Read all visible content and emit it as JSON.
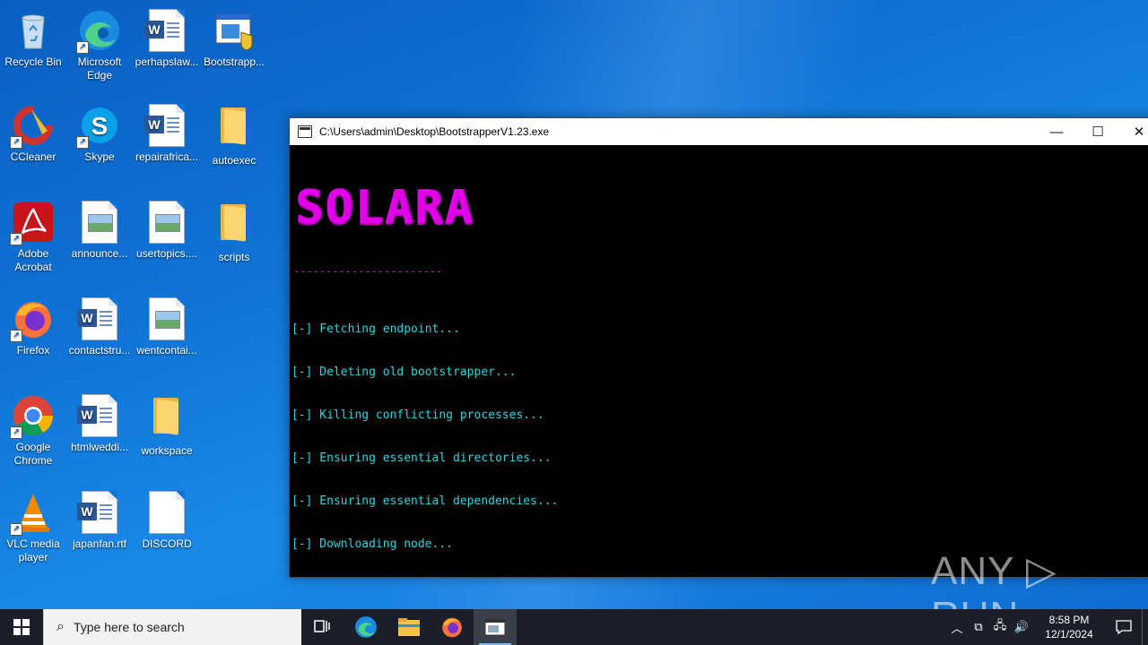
{
  "desktop": {
    "icons": [
      {
        "label": "Recycle Bin",
        "type": "recycle-bin"
      },
      {
        "label": "Microsoft Edge",
        "type": "edge"
      },
      {
        "label": "perhapslaw...",
        "type": "word-doc"
      },
      {
        "label": "Bootstrapp...",
        "type": "exe"
      },
      {
        "label": "CCleaner",
        "type": "ccleaner"
      },
      {
        "label": "Skype",
        "type": "skype"
      },
      {
        "label": "repairafrica...",
        "type": "word-doc"
      },
      {
        "label": "autoexec",
        "type": "folder"
      },
      {
        "label": "Adobe Acrobat",
        "type": "acrobat"
      },
      {
        "label": "announce...",
        "type": "image-file"
      },
      {
        "label": "usertopics....",
        "type": "image-file"
      },
      {
        "label": "scripts",
        "type": "folder"
      },
      {
        "label": "Firefox",
        "type": "firefox"
      },
      {
        "label": "contactstru...",
        "type": "word-doc"
      },
      {
        "label": "wentcontai...",
        "type": "image-file"
      },
      {
        "label": "Google Chrome",
        "type": "chrome"
      },
      {
        "label": "htmlweddi...",
        "type": "word-doc"
      },
      {
        "label": "workspace",
        "type": "folder"
      },
      {
        "label": "VLC media player",
        "type": "vlc"
      },
      {
        "label": "japanfan.rtf",
        "type": "word-doc"
      },
      {
        "label": "DISCORD",
        "type": "blank-file"
      }
    ]
  },
  "console": {
    "title": "C:\\Users\\admin\\Desktop\\BootstrapperV1.23.exe",
    "banner": "SOLARA",
    "banner_rule": "-----------------------",
    "lines": [
      "[-] Fetching endpoint...",
      "[-] Deleting old bootstrapper...",
      "[-] Killing conflicting processes...",
      "[-] Ensuring essential directories...",
      "[-] Ensuring essential dependencies...",
      "[-] Downloading node..."
    ],
    "minimize_glyph": "—",
    "maximize_glyph": "☐",
    "close_glyph": "✕"
  },
  "watermark": "ANY ▷ RUN",
  "taskbar": {
    "search_placeholder": "Type here to search",
    "time": "8:58 PM",
    "date": "12/1/2024",
    "pinned": [
      "task-view-icon",
      "edge-icon",
      "file-explorer-icon",
      "firefox-icon",
      "console-app-icon"
    ]
  },
  "colors": {
    "console_text": "#26d6e0",
    "banner": "#e100e8",
    "taskbar": "#1b1f2a"
  }
}
